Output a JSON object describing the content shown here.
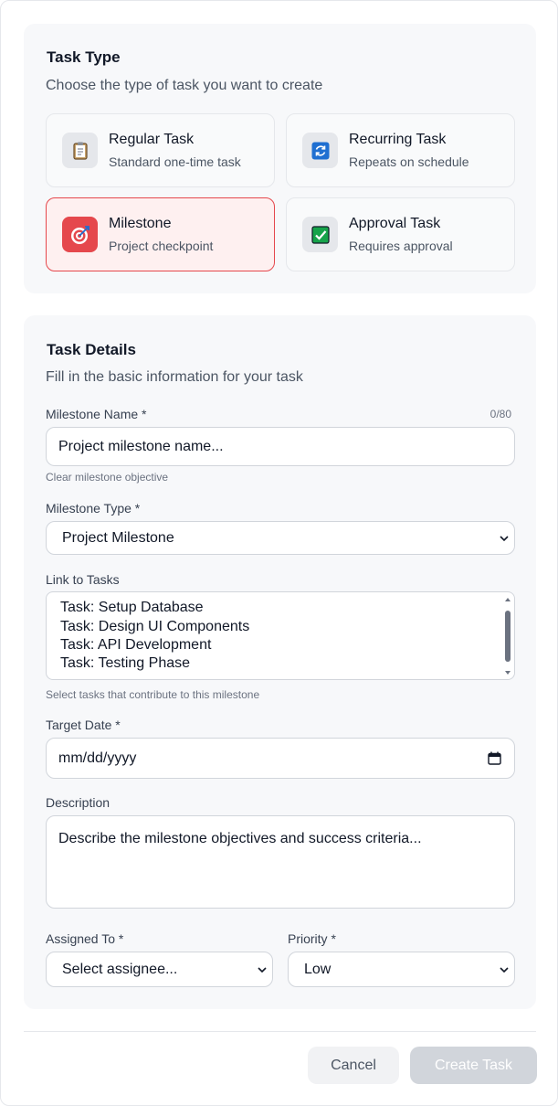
{
  "task_type": {
    "title": "Task Type",
    "subtitle": "Choose the type of task you want to create",
    "options": [
      {
        "title": "Regular Task",
        "description": "Standard one-time task",
        "icon": "clipboard-icon",
        "selected": false
      },
      {
        "title": "Recurring Task",
        "description": "Repeats on schedule",
        "icon": "repeat-icon",
        "selected": false
      },
      {
        "title": "Milestone",
        "description": "Project checkpoint",
        "icon": "target-icon",
        "selected": true
      },
      {
        "title": "Approval Task",
        "description": "Requires approval",
        "icon": "checkmark-icon",
        "selected": false
      }
    ]
  },
  "details": {
    "title": "Task Details",
    "subtitle": "Fill in the basic information for your task",
    "milestone_name": {
      "label": "Milestone Name *",
      "counter": "0/80",
      "placeholder": "Project milestone name...",
      "hint": "Clear milestone objective"
    },
    "milestone_type": {
      "label": "Milestone Type *",
      "value": "Project Milestone"
    },
    "link_tasks": {
      "label": "Link to Tasks",
      "options": [
        "Task: Setup Database",
        "Task: Design UI Components",
        "Task: API Development",
        "Task: Testing Phase"
      ],
      "hint": "Select tasks that contribute to this milestone"
    },
    "target_date": {
      "label": "Target Date *",
      "placeholder": "mm/dd/yyyy"
    },
    "description": {
      "label": "Description",
      "placeholder": "Describe the milestone objectives and success criteria..."
    },
    "assigned_to": {
      "label": "Assigned To *",
      "value": "Select assignee..."
    },
    "priority": {
      "label": "Priority *",
      "value": "Low"
    }
  },
  "actions": {
    "cancel": "Cancel",
    "create": "Create Task"
  },
  "colors": {
    "accent": "#e5484d",
    "disabled_button": "#d1d5db"
  }
}
